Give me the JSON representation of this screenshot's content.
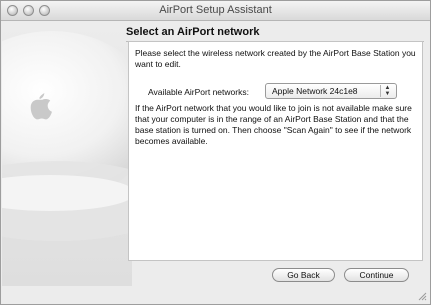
{
  "window": {
    "title": "AirPort Setup Assistant"
  },
  "main": {
    "heading": "Select an AirPort network",
    "intro": "Please select the wireless network created by the AirPort Base Station you want to edit.",
    "networks_label": "Available AirPort networks:",
    "selected_network": "Apple Network 24c1e8",
    "info": "If the AirPort network that you would like to join is not available make sure that your computer is in the range of an AirPort Base Station and that the base station is turned on. Then choose \"Scan Again\" to see if the network becomes available."
  },
  "buttons": {
    "back": "Go Back",
    "continue": "Continue"
  },
  "icons": {
    "popup": "up-down-arrows-icon",
    "resize": "resize-grip-icon"
  }
}
